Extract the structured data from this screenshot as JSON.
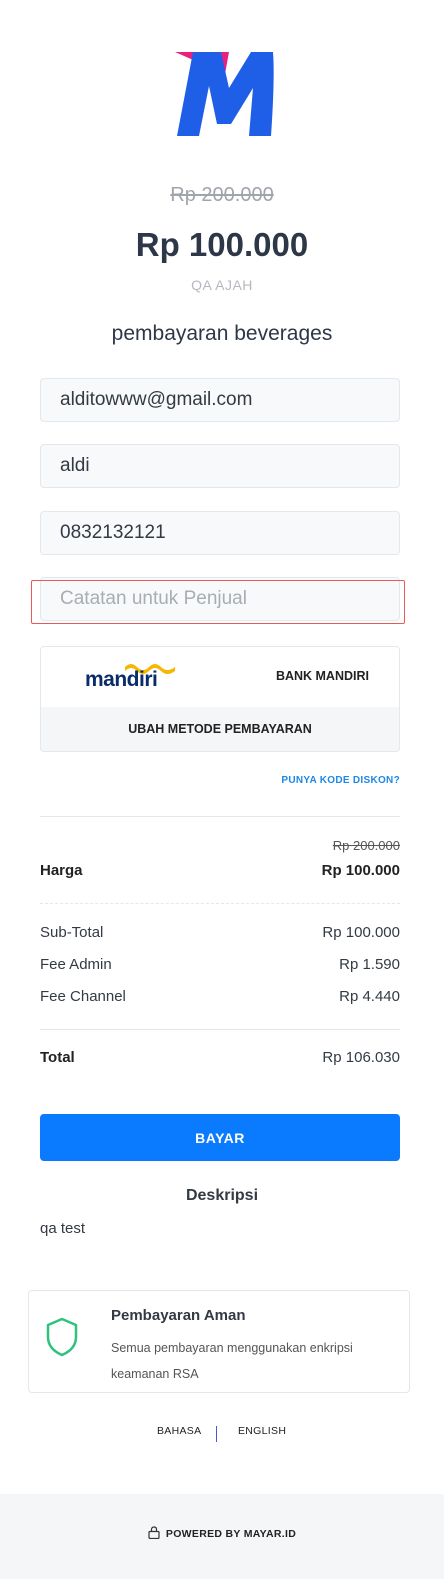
{
  "header": {
    "brand": "M",
    "original_price": "Rp 200.000",
    "price": "Rp 100.000",
    "seller": "QA AJAH",
    "product_title": "pembayaran beverages"
  },
  "form": {
    "email_value": "alditowww@gmail.com",
    "name_value": "aldi",
    "phone_value": "0832132121",
    "note_placeholder": "Catatan untuk Penjual"
  },
  "payment_method": {
    "bank_logo_text": "mandiri",
    "bank_name": "BANK MANDIRI",
    "change_label": "UBAH METODE PEMBAYARAN"
  },
  "discount_link": "PUNYA KODE DISKON?",
  "summary": {
    "original_price": "Rp 200.000",
    "price_label": "Harga",
    "price_value": "Rp 100.000",
    "subtotal_label": "Sub-Total",
    "subtotal_value": "Rp 100.000",
    "fee_admin_label": "Fee Admin",
    "fee_admin_value": "Rp 1.590",
    "fee_channel_label": "Fee Channel",
    "fee_channel_value": "Rp 4.440",
    "total_label": "Total",
    "total_value": "Rp 106.030"
  },
  "pay_button": "BAYAR",
  "description": {
    "title": "Deskripsi",
    "text": "qa test"
  },
  "secure": {
    "title": "Pembayaran Aman",
    "text": "Semua pembayaran menggunakan enkripsi keamanan RSA"
  },
  "language": {
    "label": "BAHASA",
    "current": "ENGLISH"
  },
  "footer": {
    "powered": "POWERED BY MAYAR.ID"
  },
  "colors": {
    "accent": "#0a7aff",
    "logo_blue": "#1f5fe8",
    "logo_pink": "#e8217f",
    "shield_green": "#2ec27e",
    "highlight_red": "#e55b5b"
  },
  "icons": [
    "mayar-logo-icon",
    "mandiri-logo-icon",
    "shield-icon",
    "lock-icon"
  ]
}
